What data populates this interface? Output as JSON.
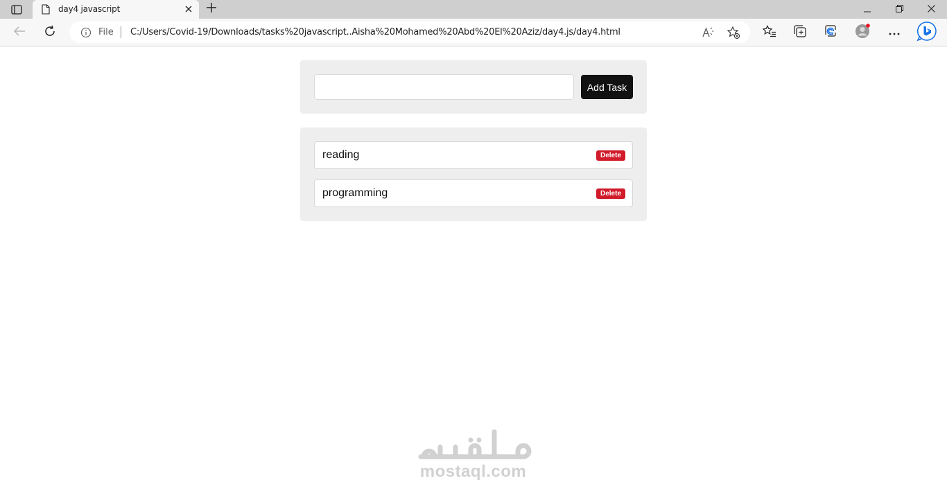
{
  "browser": {
    "tab_title": "day4 javascript",
    "address_scheme_label": "File",
    "address_url": "C:/Users/Covid-19/Downloads/tasks%20javascript..Aisha%20Mohamed%20Abd%20El%20Aziz/day4.js/day4.html",
    "icons": [
      "tab-actions-icon",
      "page-icon",
      "close-icon",
      "plus-icon",
      "minimize-icon",
      "restore-icon",
      "back-icon",
      "refresh-icon",
      "info-icon",
      "read-aloud-icon",
      "add-favorite-icon",
      "favorites-icon",
      "collections-icon",
      "browser-essentials-icon",
      "profile-avatar-icon",
      "more-icon",
      "bing-chat-icon"
    ],
    "profile_notification_color": "#e81123",
    "bing_color": "#1a73e8"
  },
  "todo": {
    "input_value": "",
    "add_button_label": "Add Task",
    "tasks": [
      {
        "text": "reading",
        "delete_label": "Delete"
      },
      {
        "text": "programming",
        "delete_label": "Delete"
      }
    ],
    "accent_color": "#111111",
    "delete_color": "#d11a2a"
  },
  "watermark": {
    "text": "mostaql.com"
  }
}
